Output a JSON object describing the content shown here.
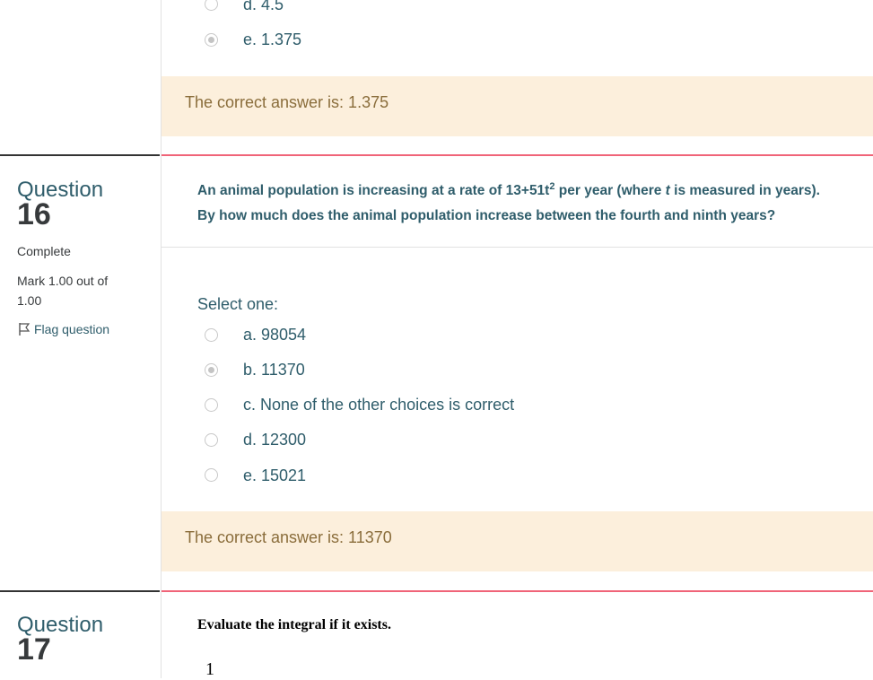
{
  "q15": {
    "options": [
      {
        "label": "d. 4.5",
        "checked": false
      },
      {
        "label": "e. 1.375",
        "checked": true
      }
    ],
    "feedback": "The correct answer is: 1.375"
  },
  "q16": {
    "question_word": "Question",
    "number": "16",
    "state": "Complete",
    "mark_line1": "Mark 1.00 out of",
    "mark_line2": "1.00",
    "flag_label": "Flag question",
    "text_line1_prefix": "An animal population is increasing at a rate of 13+51t",
    "text_line1_sup": "2",
    "text_line1_mid": " per year (where ",
    "text_line1_var": "t",
    "text_line1_suffix": " is measured in years).",
    "text_line2": "By how much does the animal population increase between the fourth and ninth years?",
    "select_prompt": "Select one:",
    "options": [
      {
        "label": "a. 98054",
        "checked": false
      },
      {
        "label": "b. 11370",
        "checked": true
      },
      {
        "label": "c. None of the other choices is correct",
        "checked": false
      },
      {
        "label": "d. 12300",
        "checked": false
      },
      {
        "label": "e. 15021",
        "checked": false
      }
    ],
    "feedback": "The correct answer is: 11370"
  },
  "q17": {
    "question_word": "Question",
    "number": "17",
    "text": "Evaluate the integral if it exists.",
    "integral_upper": "1"
  }
}
